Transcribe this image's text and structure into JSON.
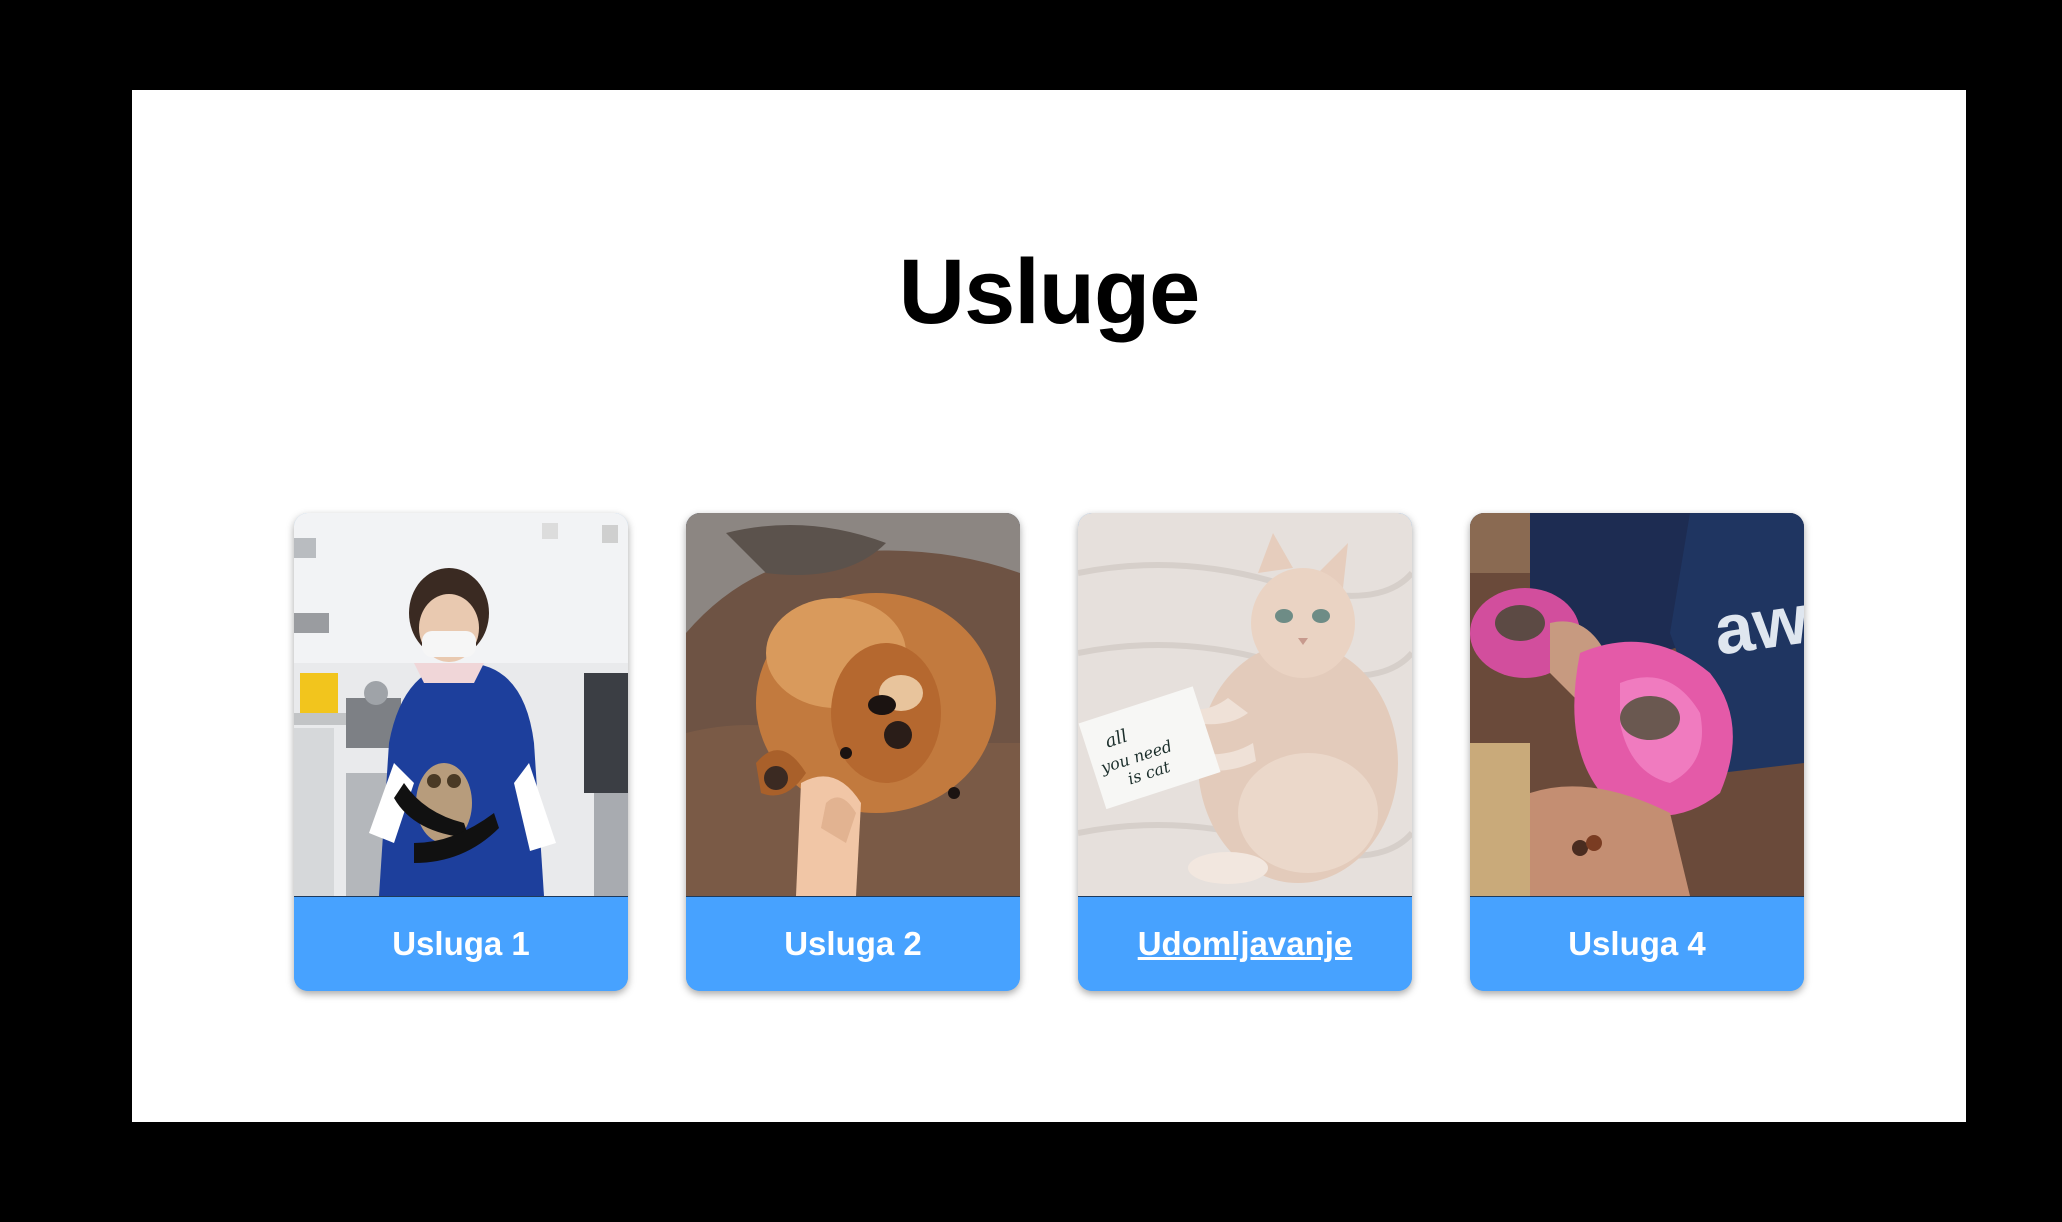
{
  "section": {
    "title": "Usluge"
  },
  "services": [
    {
      "label": "Usluga 1",
      "image": "veterinarian-holding-owl-photo"
    },
    {
      "label": "Usluga 2",
      "image": "dog-lying-on-back-photo"
    },
    {
      "label": "Udomljavanje",
      "image": "cat-with-note-photo",
      "note_text": "all you need is cat"
    },
    {
      "label": "Usluga 4",
      "image": "kittens-in-pink-towels-photo"
    }
  ],
  "colors": {
    "page_background": "#ffffff",
    "outer_background": "#000000",
    "card_label_background": "#47a2ff",
    "card_label_text": "#ffffff",
    "title_text": "#000000"
  }
}
